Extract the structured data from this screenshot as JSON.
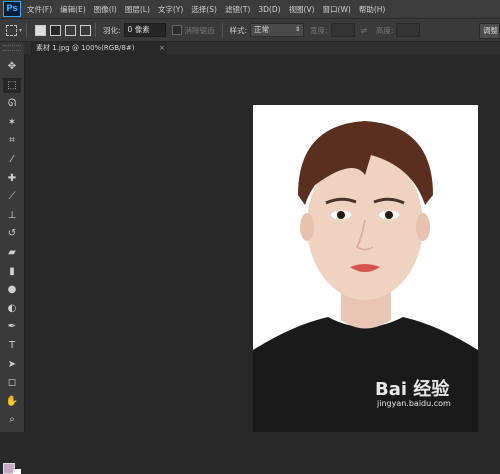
{
  "app": {
    "logo": "Ps"
  },
  "menu": [
    "文件(F)",
    "编辑(E)",
    "图像(I)",
    "图层(L)",
    "文字(Y)",
    "选择(S)",
    "滤镜(T)",
    "3D(D)",
    "视图(V)",
    "窗口(W)",
    "帮助(H)"
  ],
  "options": {
    "feather_label": "羽化:",
    "feather_value": "0 像素",
    "antialias_label": "消除锯齿",
    "style_label": "样式:",
    "style_value": "正常",
    "width_label": "宽度:",
    "height_label": "高度:",
    "adjust_label": "调整"
  },
  "document": {
    "tab_title": "素材 1.jpg @ 100%(RGB/8#)",
    "close_glyph": "×"
  },
  "toolbar": {
    "tools": [
      {
        "name": "move-tool-icon",
        "glyph": "✥"
      },
      {
        "name": "marquee-tool-icon",
        "glyph": "⬚",
        "active": true
      },
      {
        "name": "lasso-tool-icon",
        "glyph": "ᘏ"
      },
      {
        "name": "quick-select-tool-icon",
        "glyph": "✶"
      },
      {
        "name": "crop-tool-icon",
        "glyph": "⌗"
      },
      {
        "name": "eyedropper-tool-icon",
        "glyph": "⁄"
      },
      {
        "name": "healing-brush-tool-icon",
        "glyph": "✚"
      },
      {
        "name": "brush-tool-icon",
        "glyph": "⟋"
      },
      {
        "name": "clone-stamp-tool-icon",
        "glyph": "⊥"
      },
      {
        "name": "history-brush-tool-icon",
        "glyph": "↺"
      },
      {
        "name": "eraser-tool-icon",
        "glyph": "▰"
      },
      {
        "name": "gradient-tool-icon",
        "glyph": "▮"
      },
      {
        "name": "blur-tool-icon",
        "glyph": "●"
      },
      {
        "name": "dodge-tool-icon",
        "glyph": "◐"
      },
      {
        "name": "pen-tool-icon",
        "glyph": "✒"
      },
      {
        "name": "type-tool-icon",
        "glyph": "T"
      },
      {
        "name": "path-select-tool-icon",
        "glyph": "➤"
      },
      {
        "name": "shape-tool-icon",
        "glyph": "◻"
      },
      {
        "name": "hand-tool-icon",
        "glyph": "✋"
      },
      {
        "name": "zoom-tool-icon",
        "glyph": "⌕"
      }
    ],
    "foreground_color": "#c9a8c4",
    "background_color": "#ffffff"
  },
  "watermark": {
    "logo": "Bai 经验",
    "url": "jingyan.baidu.com"
  }
}
